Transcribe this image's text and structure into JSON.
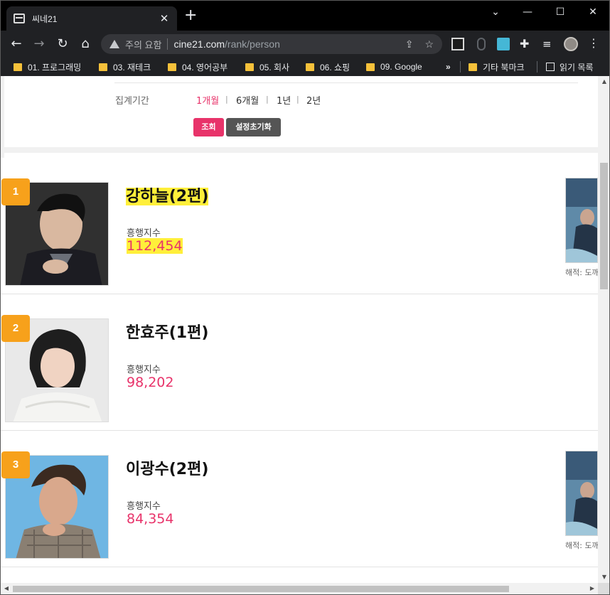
{
  "browser": {
    "tab_title": "씨네21",
    "address": {
      "warning": "주의 요함",
      "host": "cine21.com",
      "path": "/rank/person"
    },
    "bookmarks": [
      {
        "label": "01. 프로그래밍"
      },
      {
        "label": "03. 재테크"
      },
      {
        "label": "04. 영어공부"
      },
      {
        "label": "05. 회사"
      },
      {
        "label": "06. 쇼핑"
      },
      {
        "label": "09. Google"
      }
    ],
    "overflow_label": "»",
    "other_bookmarks": "기타 북마크",
    "reading_list": "읽기 목록"
  },
  "filter": {
    "period_label": "집계기간",
    "options": [
      "1개월",
      "6개월",
      "1년",
      "2년"
    ],
    "active_option": "1개월",
    "search_button": "조회",
    "reset_button": "설정초기화"
  },
  "rankings": [
    {
      "rank": "1",
      "name": "강하늘(2편)",
      "metric_label": "흥행지수",
      "value": "112,454",
      "poster_caption": "해적: 도깨",
      "has_poster": true,
      "highlighted": true
    },
    {
      "rank": "2",
      "name": "한효주(1편)",
      "metric_label": "흥행지수",
      "value": "98,202",
      "has_poster": false,
      "highlighted": false
    },
    {
      "rank": "3",
      "name": "이광수(2편)",
      "metric_label": "흥행지수",
      "value": "84,354",
      "poster_caption": "해적: 도깨",
      "has_poster": true,
      "highlighted": false
    }
  ],
  "colors": {
    "accent": "#e8336a",
    "rank_badge": "#f7a11b",
    "highlight": "#ffef3a"
  }
}
